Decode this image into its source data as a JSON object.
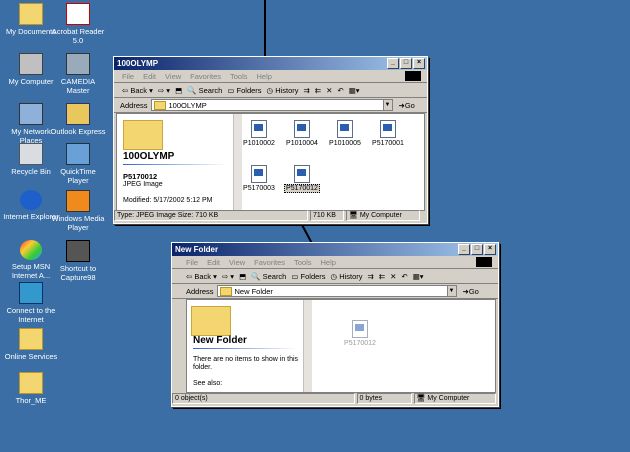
{
  "desktop_icons": [
    {
      "label": "My Documents",
      "icon": "my-documents-icon"
    },
    {
      "label": "Acrobat Reader 5.0",
      "icon": "acrobat-icon"
    },
    {
      "label": "My Computer",
      "icon": "my-computer-icon"
    },
    {
      "label": "CAMEDIA Master",
      "icon": "camedia-icon"
    },
    {
      "label": "My Network Places",
      "icon": "network-icon"
    },
    {
      "label": "Outlook Express",
      "icon": "outlook-icon"
    },
    {
      "label": "Recycle Bin",
      "icon": "recycle-bin-icon"
    },
    {
      "label": "QuickTime Player",
      "icon": "quicktime-icon"
    },
    {
      "label": "Internet Explorer",
      "icon": "ie-icon"
    },
    {
      "label": "Windows Media Player",
      "icon": "media-player-icon"
    },
    {
      "label": "Setup MSN Internet A...",
      "icon": "msn-icon"
    },
    {
      "label": "Shortcut to Capture98",
      "icon": "capture-icon"
    },
    {
      "label": "Connect to the Internet",
      "icon": "connect-icon"
    },
    {
      "label": "Online Services",
      "icon": "folder-icon"
    },
    {
      "label": "Thor_ME",
      "icon": "folder-icon"
    }
  ],
  "menu": {
    "file": "File",
    "edit": "Edit",
    "view": "View",
    "favorites": "Favorites",
    "tools": "Tools",
    "help": "Help"
  },
  "toolbar": {
    "back": "Back",
    "search": "Search",
    "folders": "Folders",
    "history": "History"
  },
  "address_label": "Address",
  "go_label": "Go",
  "window1": {
    "title": "100OLYMP",
    "address": "100OLYMP",
    "pane_title": "100OLYMP",
    "selected_name": "P5170012",
    "selected_type": "JPEG Image",
    "modified": "Modified: 5/17/2002 5:12 PM",
    "files": [
      "P1010002",
      "P1010004",
      "P1010005",
      "P5170001",
      "P5170003",
      "P5170012"
    ],
    "status_left": "Type: JPEG Image Size: 710 KB",
    "status_size": "710 KB",
    "status_location": "My Computer"
  },
  "window2": {
    "title": "New Folder",
    "address": "New Folder",
    "pane_title": "New Folder",
    "empty_msg": "There are no items to show in this folder.",
    "see_also": "See also:",
    "dragged_file": "P5170012",
    "status_left": "0 object(s)",
    "status_size": "0 bytes",
    "status_location": "My Computer"
  }
}
